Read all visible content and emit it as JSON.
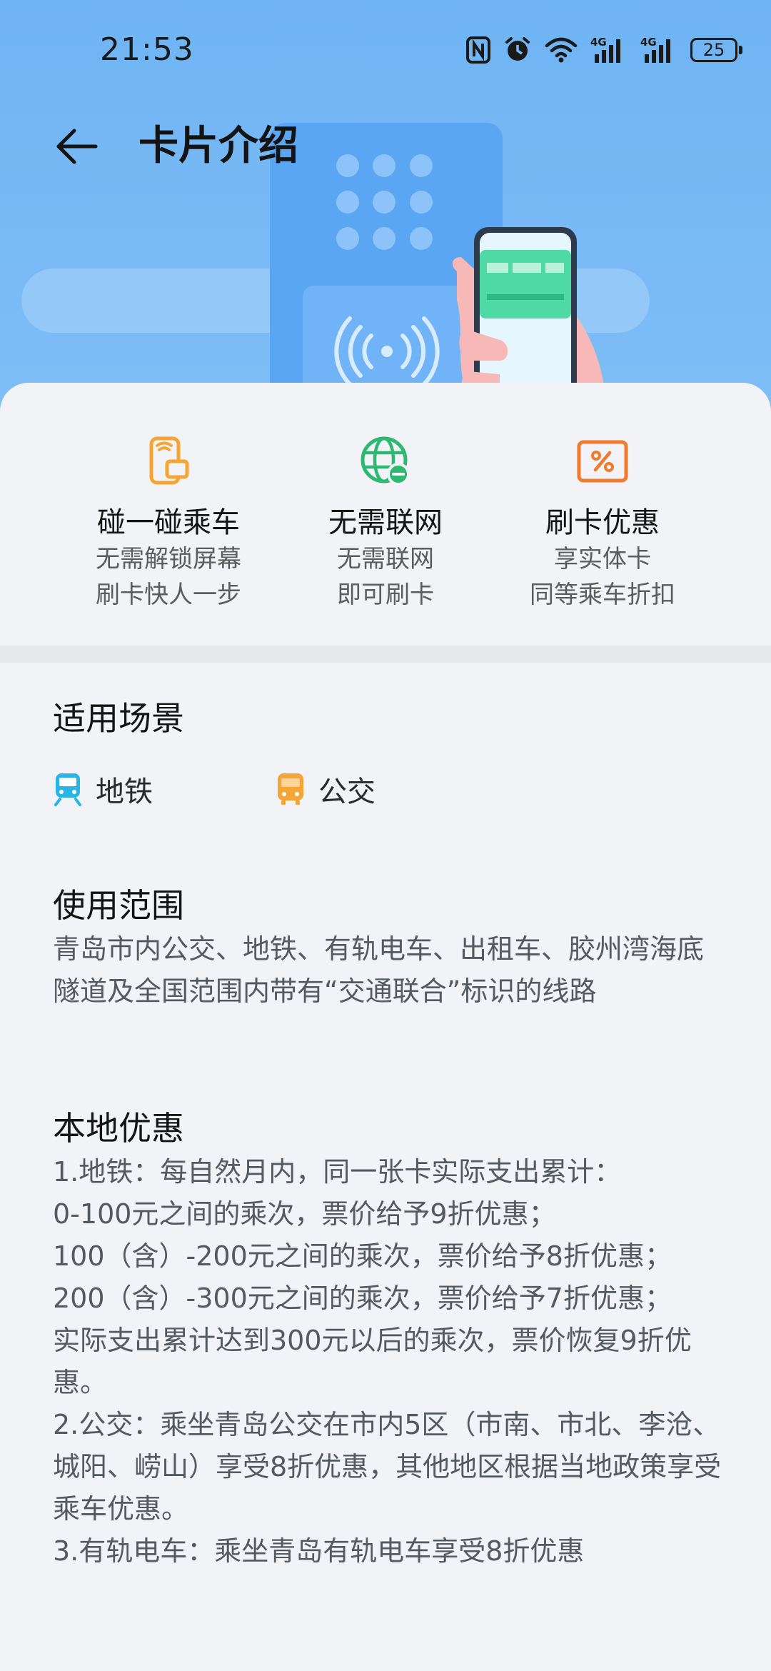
{
  "status_bar": {
    "time": "21:53",
    "battery": "25",
    "network_1": "4G",
    "network_2": "4G"
  },
  "header": {
    "title": "卡片介绍"
  },
  "features": [
    {
      "icon": "phone-tap-icon",
      "name": "碰一碰乘车",
      "desc_line1": "无需解锁屏幕",
      "desc_line2": "刷卡快人一步"
    },
    {
      "icon": "globe-offline-icon",
      "name": "无需联网",
      "desc_line1": "无需联网",
      "desc_line2": "即可刷卡"
    },
    {
      "icon": "discount-icon",
      "name": "刷卡优惠",
      "desc_line1": "享实体卡",
      "desc_line2": "同等乘车折扣"
    }
  ],
  "scenes": {
    "title": "适用场景",
    "items": [
      {
        "icon": "metro-icon",
        "label": "地铁",
        "color": "#29b6e6"
      },
      {
        "icon": "bus-icon",
        "label": "公交",
        "color": "#f5a533"
      }
    ]
  },
  "scope": {
    "title": "使用范围",
    "text": "青岛市内公交、地铁、有轨电车、出租车、胶州湾海底隧道及全国范围内带有“交通联合”标识的线路"
  },
  "local_offers": {
    "title": "本地优惠",
    "lines": [
      "1.地铁：每自然月内，同一张卡实际支出累计：",
      "0-100元之间的乘次，票价给予9折优惠；",
      "100（含）-200元之间的乘次，票价给予8折优惠；",
      "200（含）-300元之间的乘次，票价给予7折优惠；",
      "实际支出累计达到300元以后的乘次，票价恢复9折优惠。",
      "2.公交：乘坐青岛公交在市内5区（市南、市北、李沧、城阳、崂山）享受8折优惠，其他地区根据当地政策享受乘车优惠。",
      "3.有轨电车：乘坐青岛有轨电车享受8折优惠"
    ]
  },
  "colors": {
    "hero_bg": "#78baf5",
    "accent_orange": "#f5a533",
    "accent_green": "#2eb872"
  }
}
